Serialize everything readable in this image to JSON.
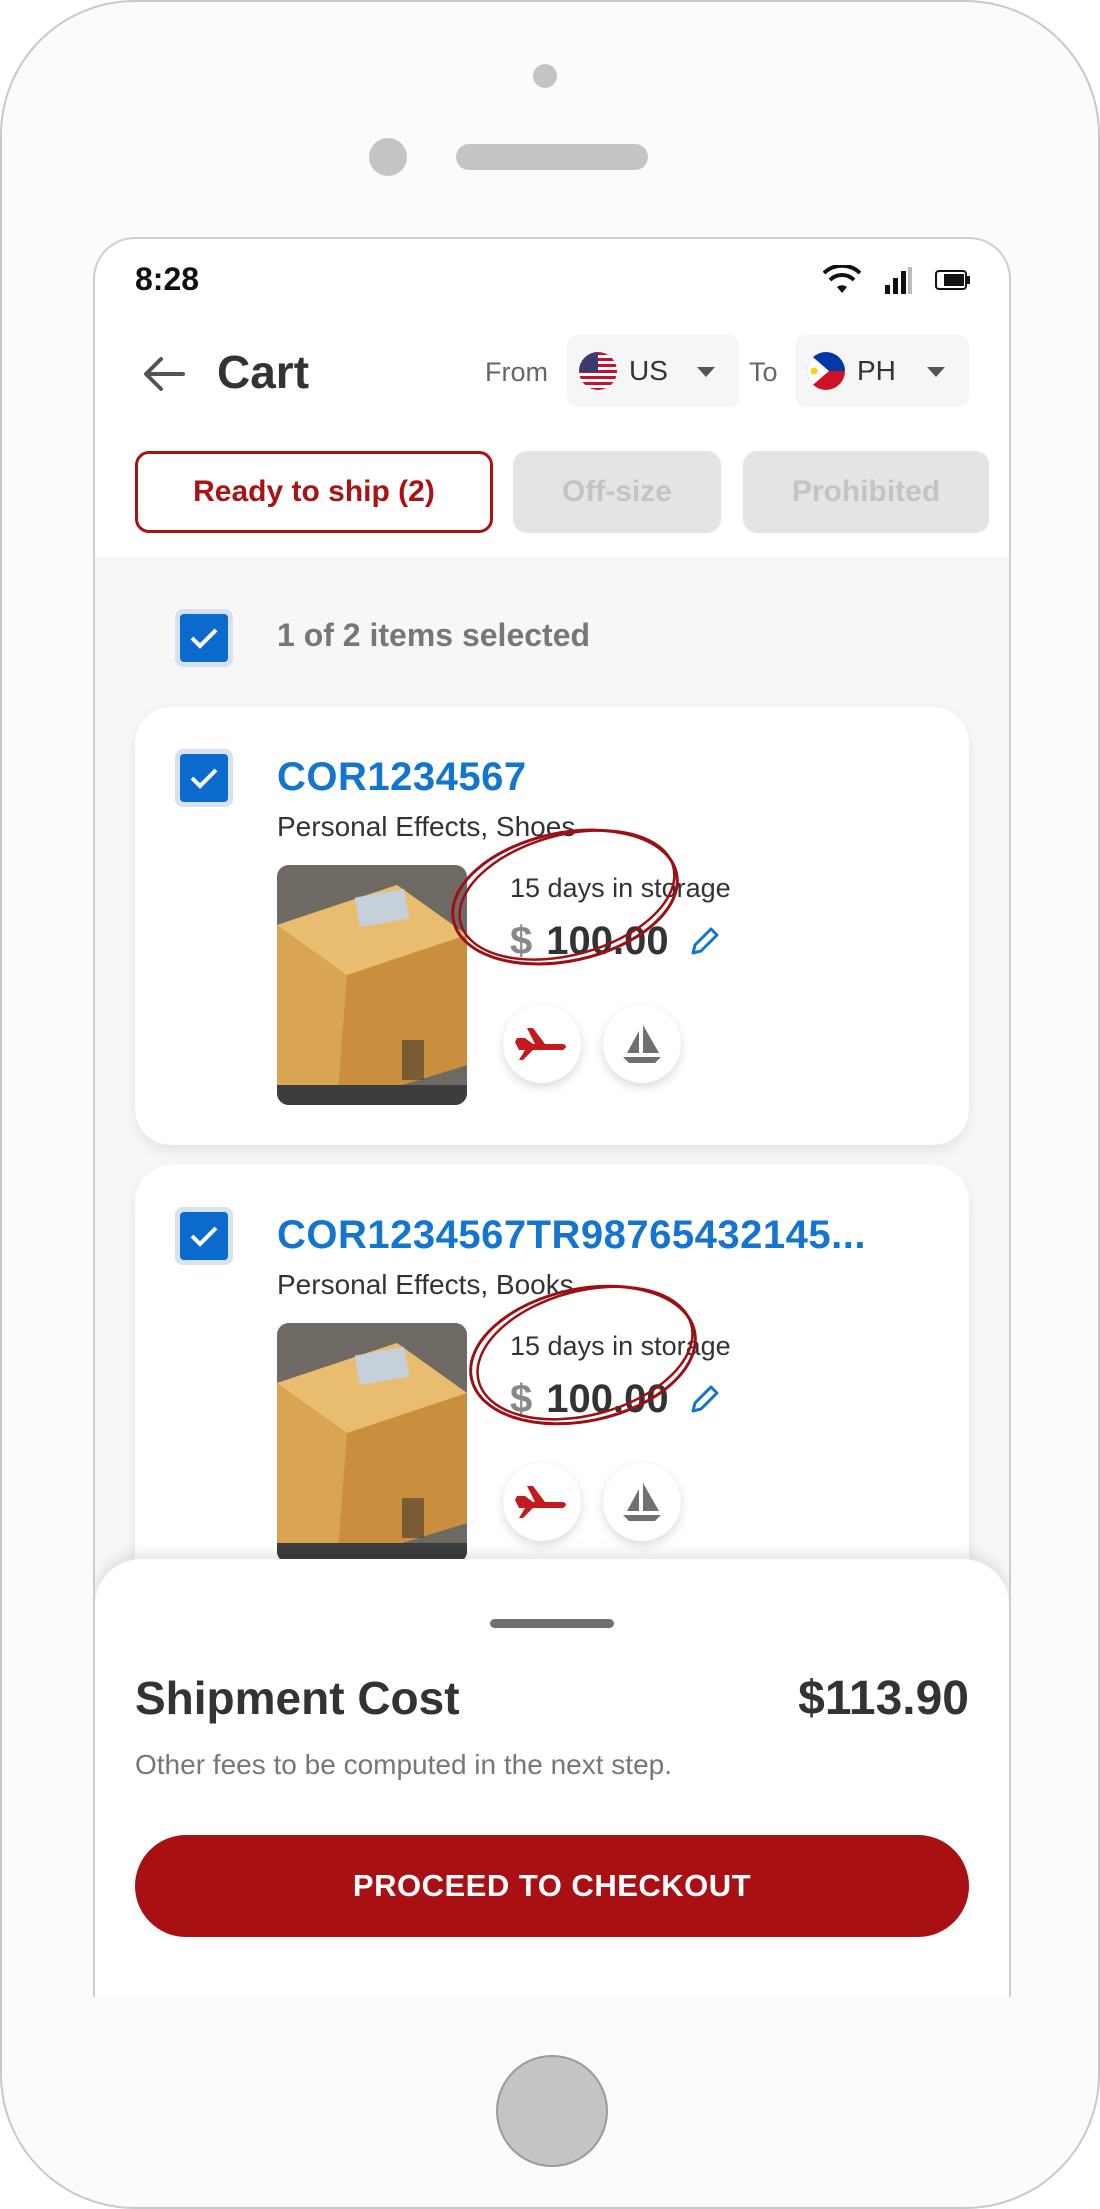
{
  "status_bar": {
    "time": "8:28",
    "icons": [
      "wifi-icon",
      "signal-icon",
      "battery-icon"
    ]
  },
  "header": {
    "title": "Cart",
    "from_label": "From",
    "from_country": "US",
    "to_label": "To",
    "to_country": "PH"
  },
  "tabs": [
    {
      "label": "Ready to ship (2)",
      "active": true
    },
    {
      "label": "Off-size",
      "active": false
    },
    {
      "label": "Prohibited",
      "active": false
    }
  ],
  "selection": {
    "text": "1 of 2 items selected",
    "checked": true
  },
  "items": [
    {
      "code": "COR1234567",
      "category": "Personal Effects, Shoes",
      "storage": "15 days in storage",
      "currency": "$",
      "price": "100.00",
      "checked": true,
      "modes": [
        "air-freight-icon",
        "sea-freight-icon"
      ]
    },
    {
      "code": "COR1234567TR98765432145...",
      "category": "Personal Effects, Books",
      "storage": "15 days in storage",
      "currency": "$",
      "price": "100.00",
      "checked": true,
      "modes": [
        "air-freight-icon",
        "sea-freight-icon"
      ]
    }
  ],
  "summary": {
    "label": "Shipment Cost",
    "value": "$113.90",
    "note": "Other fees to be computed in the next step.",
    "checkout_label": "PROCEED TO CHECKOUT"
  },
  "colors": {
    "brand_red": "#a81014",
    "link_blue": "#1475cf",
    "checkbox_blue": "#0a6bcc",
    "annotation_red": "#9b1016"
  }
}
